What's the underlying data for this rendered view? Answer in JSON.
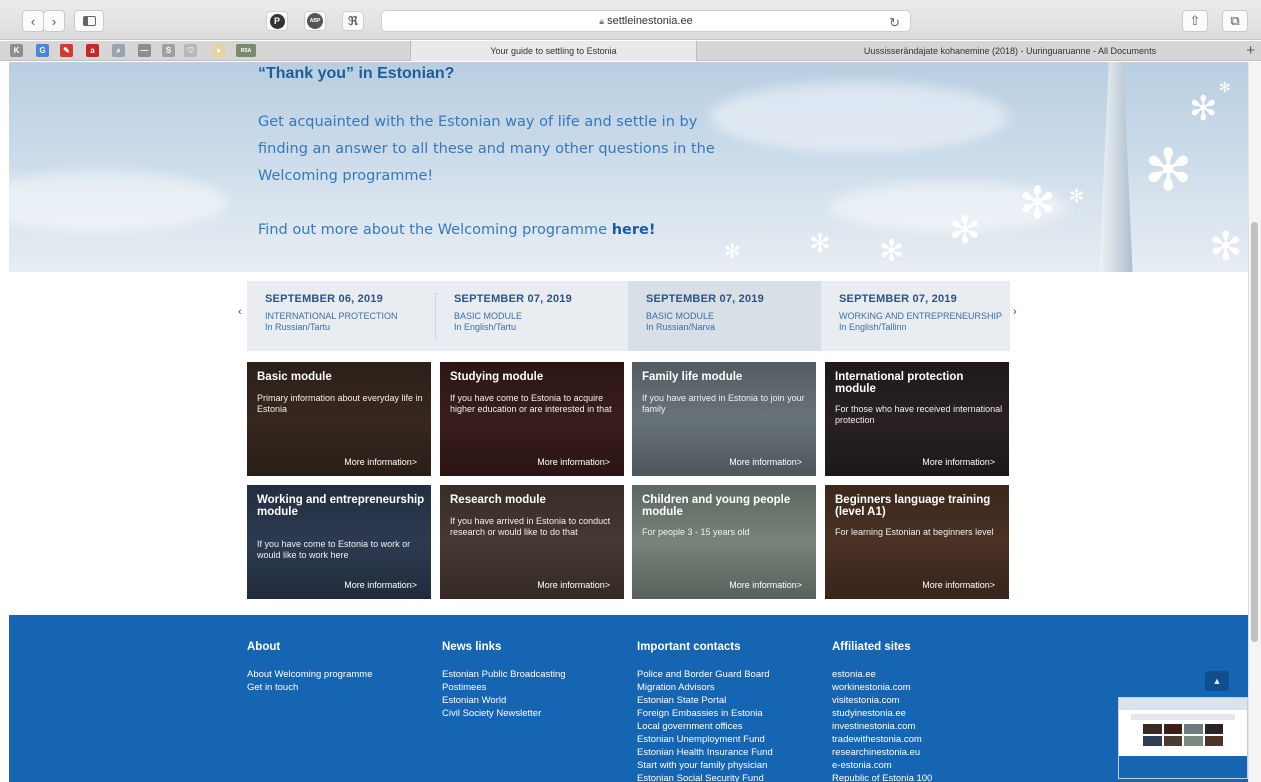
{
  "browser": {
    "url": "settleinestonia.ee",
    "tabs": [
      {
        "title": "Your guide to settling to Estonia",
        "active": true
      },
      {
        "title": "Uussisserändajate kohanemine (2018) - Uuringuaruanne - All Documents",
        "active": false
      }
    ],
    "extensions": [
      {
        "icon": "pinterest-icon",
        "label": "P"
      },
      {
        "icon": "adblock-icon",
        "label": "ABP"
      },
      {
        "icon": "reader-icon",
        "label": "ℜ"
      }
    ],
    "bookmarks": [
      {
        "icon": "k-icon",
        "label": "K",
        "color": "#8e8e8e"
      },
      {
        "icon": "google-translate-icon",
        "label": "G",
        "color": "#4a86d8"
      },
      {
        "icon": "pdf-icon",
        "label": "✎",
        "color": "#d23a2b"
      },
      {
        "icon": "a-icon",
        "label": "a",
        "color": "#c62828"
      },
      {
        "icon": "search-glass-icon",
        "label": "⌕",
        "color": "#9aa4ae"
      },
      {
        "icon": "dash-icon",
        "label": "—",
        "color": "#8d8d8d"
      },
      {
        "icon": "s-icon",
        "label": "S",
        "color": "#a0a0a0"
      },
      {
        "icon": "heart-icon",
        "label": "♡",
        "color": "#b8b8b8"
      },
      {
        "icon": "circle-icon",
        "label": "●",
        "color": "#e4d5a0"
      },
      {
        "icon": "rsa-icon",
        "label": "RSA",
        "color": "#7a8a6a"
      }
    ]
  },
  "hero": {
    "title": "“Thank you” in Estonian?",
    "paragraph": "Get acquainted with the Estonian way of life and settle in by finding an answer to all these and many other questions in the Welcoming programme!",
    "link_prefix": "Find out more about the Welcoming programme ",
    "link_text": "here!"
  },
  "events": [
    {
      "date": "SEPTEMBER 06, 2019",
      "type": "INTERNATIONAL PROTECTION",
      "lang": "In Russian/Tartu"
    },
    {
      "date": "SEPTEMBER 07, 2019",
      "type": "BASIC MODULE",
      "lang": "In English/Tartu"
    },
    {
      "date": "SEPTEMBER 07, 2019",
      "type": "BASIC MODULE",
      "lang": "In Russian/Narva"
    },
    {
      "date": "SEPTEMBER 07, 2019",
      "type": "WORKING AND ENTREPRENEURSHIP",
      "lang": "In English/Tallinn"
    }
  ],
  "nav": {
    "prev": "‹",
    "next": "›"
  },
  "modules": [
    {
      "title": "Basic module",
      "desc": "Primary information about everyday life in Estonia",
      "more": "More information>",
      "bg": "#3a2a20"
    },
    {
      "title": "Studying module",
      "desc": "If you have come to Estonia to acquire higher education or are interested in that",
      "more": "More information>",
      "bg": "#3b1e1c"
    },
    {
      "title": "Family life module",
      "desc": "If you have arrived in Estonia to join your family",
      "more": "More information>",
      "bg": "#6e7a80"
    },
    {
      "title": "International protection module",
      "desc": "For those who have received international protection",
      "more": "More information>",
      "bg": "#2a2225"
    },
    {
      "title": "Working and entrepreneurship module",
      "desc": "If you have come to Estonia to work or would like to work here",
      "more": "More information>",
      "bg": "#2f3d55"
    },
    {
      "title": "Research module",
      "desc": "If you have arrived in Estonia to conduct research or would like to do that",
      "more": "More information>",
      "bg": "#4a3b34"
    },
    {
      "title": "Children and young people module",
      "desc": "For people 3 - 15 years old",
      "more": "More information>",
      "bg": "#7d8a82"
    },
    {
      "title": "Beginners language training (level A1)",
      "desc": "For learning Estonian at beginners level",
      "more": "More information>",
      "bg": "#4e3426"
    }
  ],
  "footer": {
    "about": {
      "heading": "About",
      "links": [
        "About Welcoming programme",
        "Get in touch"
      ]
    },
    "news": {
      "heading": "News links",
      "links": [
        "Estonian Public Broadcasting",
        "Postimees",
        "Estonian World",
        "Civil Society Newsletter"
      ]
    },
    "contacts": {
      "heading": "Important contacts",
      "links": [
        "Police and Border Guard Board",
        "Migration Advisors",
        "Estonian State Portal",
        "Foreign Embassies in Estonia",
        "Local government offices",
        "Estonian Unemployment Fund",
        "Estonian Health Insurance Fund",
        "Start with your family physician",
        "Estonian Social Security Fund"
      ]
    },
    "affiliated": {
      "heading": "Affiliated sites",
      "links": [
        "estonia.ee",
        "workinestonia.com",
        "visitestonia.com",
        "studyinestonia.ee",
        "investinestonia.com",
        "tradewithestonia.com",
        "researchinestonia.eu",
        "e-estonia.com",
        "Republic of Estonia 100"
      ]
    }
  },
  "colors": {
    "footer_bg": "#1565b2",
    "hero_text": "#3479bd",
    "event_text": "#2a5585"
  }
}
